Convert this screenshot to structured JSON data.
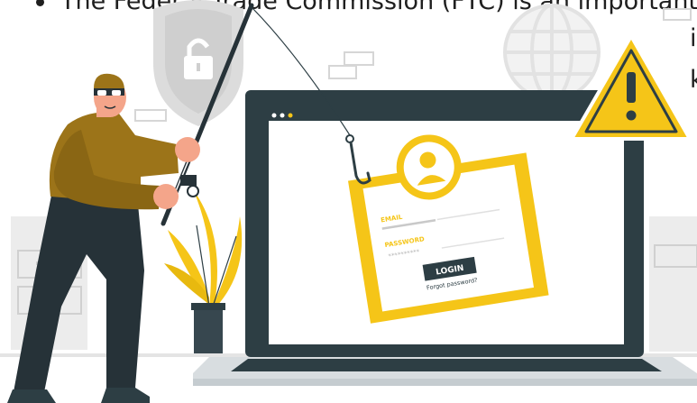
{
  "slide": {
    "bullet_text": "The Federal Trade Commission (FTC) is an important",
    "fragment_line2": "i",
    "fragment_line3": "k"
  },
  "login_card": {
    "email_label": "EMAIL",
    "password_label": "PASSWORD",
    "password_mask": "**********",
    "login_button": "LOGIN",
    "forgot_link": "Forgot password?"
  },
  "colors": {
    "accent_yellow": "#f5c518",
    "dark_teal": "#2d3e44",
    "shirt": "#9c7419",
    "pants": "#263238",
    "warning_fill": "#f5c518"
  },
  "icons": [
    "lock-shield-icon",
    "globe-icon",
    "warning-icon",
    "user-avatar-icon",
    "fish-hook-icon"
  ]
}
